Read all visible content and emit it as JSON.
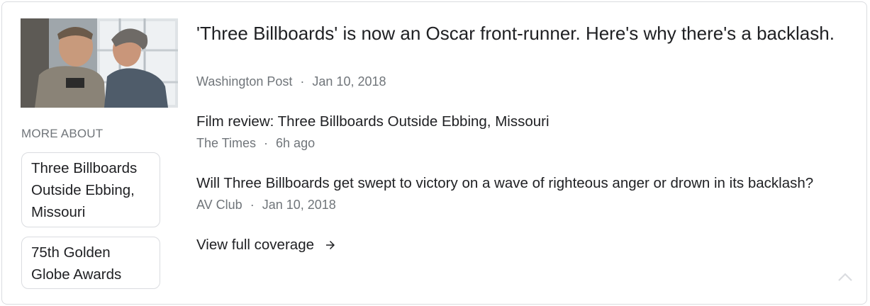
{
  "more_about": {
    "heading": "MORE ABOUT",
    "chips": [
      {
        "label": "Three Billboards Outside Ebbing, Missouri"
      },
      {
        "label": "75th Golden Globe Awards"
      }
    ]
  },
  "top_story": {
    "headline": "'Three Billboards' is now an Oscar front-runner. Here's why there's a backlash.",
    "source": "Washington Post",
    "date": "Jan 10, 2018"
  },
  "stories": [
    {
      "title": "Film review: Three Billboards Outside Ebbing, Missouri",
      "source": "The Times",
      "date": "6h ago"
    },
    {
      "title": "Will Three Billboards get swept to victory on a wave of righteous anger or drown in its backlash?",
      "source": "AV Club",
      "date": "Jan 10, 2018"
    }
  ],
  "coverage": {
    "label": "View full coverage"
  },
  "separator": "·",
  "icons": {
    "arrow": "arrow-right-icon",
    "collapse": "chevron-up-icon"
  },
  "colors": {
    "text": "#202124",
    "secondary": "#70757a",
    "border": "#dadce0"
  }
}
